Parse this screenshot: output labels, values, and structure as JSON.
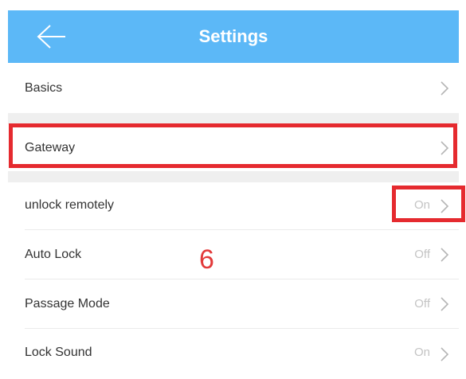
{
  "header": {
    "title": "Settings",
    "back_icon": "arrow-left-icon"
  },
  "rows": [
    {
      "label": "Basics",
      "value": ""
    },
    {
      "label": "Gateway",
      "value": ""
    },
    {
      "label": "unlock remotely",
      "value": "On"
    },
    {
      "label": "Auto Lock",
      "value": "Off"
    },
    {
      "label": "Passage Mode",
      "value": "Off"
    },
    {
      "label": "Lock Sound",
      "value": "On"
    }
  ],
  "annotation": {
    "step_number": "6"
  },
  "colors": {
    "header_bg": "#5cb8f7",
    "highlight": "#e52a2f",
    "annotation": "#e23a3a"
  }
}
